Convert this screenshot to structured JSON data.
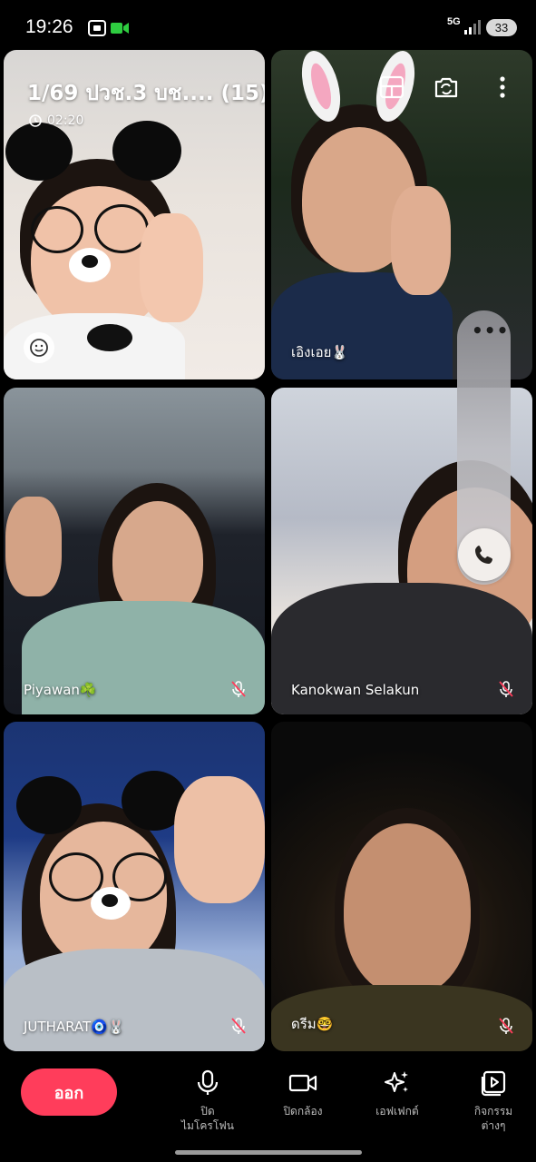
{
  "status_bar": {
    "time": "19:26",
    "network": "5G",
    "battery": "33"
  },
  "call": {
    "title": "1/69 ปวช.3 บช.... (15)",
    "duration": "02:20"
  },
  "participants": [
    {
      "name": "",
      "muted": false
    },
    {
      "name": "เอิงเอย🐰",
      "muted": false
    },
    {
      "name": "Piyawan☘️",
      "muted": true
    },
    {
      "name": "Kanokwan Selakun",
      "muted": true
    },
    {
      "name": "JUTHARAT🧿🐰",
      "muted": true
    },
    {
      "name": "ดรีม🤓",
      "muted": true
    }
  ],
  "bottom_bar": {
    "leave_label": "ออก",
    "mic_label": "ปิด\nไมโครโฟน",
    "camera_label": "ปิดกล้อง",
    "effects_label": "เอฟเฟกต์",
    "activities_label": "กิจกรรม\nต่างๆ"
  },
  "colors": {
    "leave_button": "#ff3d5b",
    "background": "#000000"
  },
  "icons": {
    "layout": "layout-grid-icon",
    "switch_camera": "switch-camera-icon",
    "more": "more-vertical-icon",
    "emoji": "emoji-icon",
    "phone": "phone-icon",
    "mic": "microphone-icon",
    "camera": "video-camera-icon",
    "effects": "sparkle-icon",
    "activities": "activities-icon"
  }
}
